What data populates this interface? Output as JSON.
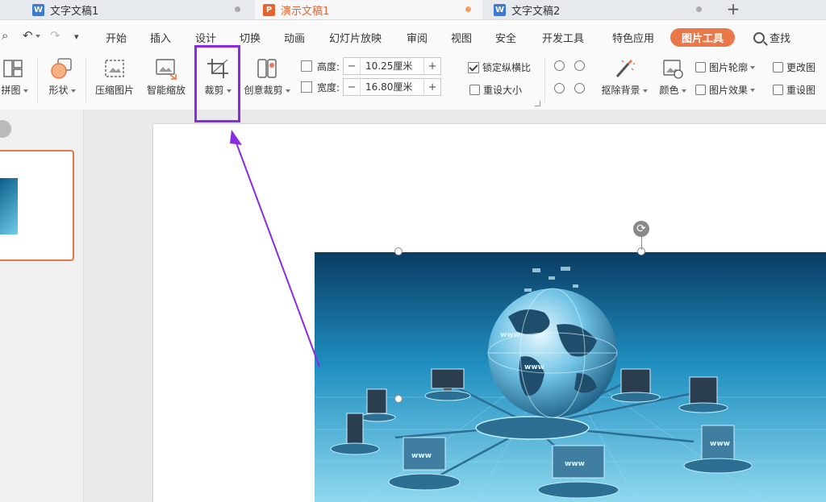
{
  "tabs": [
    {
      "label": "文字文稿1",
      "icon": "W",
      "color": "#3a7bd5"
    },
    {
      "label": "演示文稿1",
      "icon": "P",
      "color": "#e8642e"
    },
    {
      "label": "文字文稿2",
      "icon": "W",
      "color": "#3a7bd5"
    }
  ],
  "add_tab": "+",
  "menu": {
    "items": [
      "开始",
      "插入",
      "设计",
      "切换",
      "动画",
      "幻灯片放映",
      "审阅",
      "视图",
      "安全",
      "开发工具",
      "特色应用"
    ],
    "active": "图片工具",
    "find": "查找"
  },
  "ribbon": {
    "collage": "拼图",
    "shape": "形状",
    "compress": "压缩图片",
    "smart_zoom": "智能缩放",
    "crop": "裁剪",
    "creative_crop": "创意裁剪",
    "height_label": "高度:",
    "height_value": "10.25厘米",
    "width_label": "宽度:",
    "width_value": "16.80厘米",
    "minus": "−",
    "plus": "+",
    "lock_ratio": "锁定纵横比",
    "reset_size": "重设大小",
    "remove_bg": "抠除背景",
    "color": "颜色",
    "outline": "图片轮廓",
    "effect": "图片效果",
    "change_pic": "更改图",
    "reset_pic": "重设图"
  },
  "colors": {
    "accent": "#e8784a",
    "highlight": "#8a2be2",
    "arrow": "#8a2be2"
  },
  "picture": {
    "subject": "globe-network-image",
    "label": "www"
  }
}
